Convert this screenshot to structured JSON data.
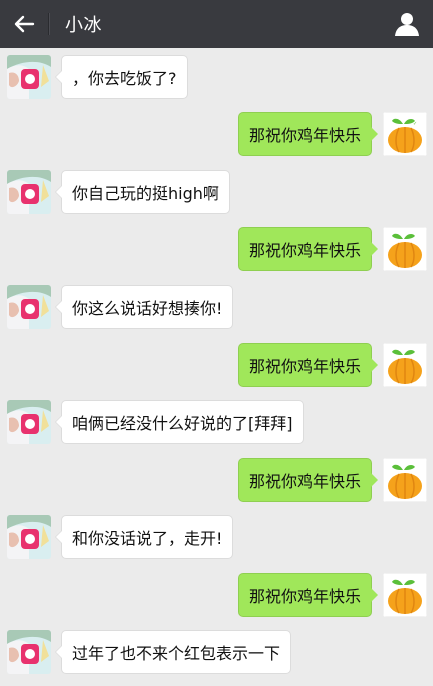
{
  "header": {
    "title": "小冰",
    "back_icon": "arrow-left-icon",
    "profile_icon": "person-icon"
  },
  "colors": {
    "header_bg": "#393a3f",
    "chat_bg": "#ebebeb",
    "bubble_sent": "#a0e75a",
    "bubble_received": "#ffffff"
  },
  "messages": [
    {
      "side": "left",
      "text": "，你去吃饭了?"
    },
    {
      "side": "right",
      "text": "那祝你鸡年快乐"
    },
    {
      "side": "left",
      "text": "你自己玩的挺high啊"
    },
    {
      "side": "right",
      "text": "那祝你鸡年快乐"
    },
    {
      "side": "left",
      "text": "你这么说话好想揍你!"
    },
    {
      "side": "right",
      "text": "那祝你鸡年快乐"
    },
    {
      "side": "left",
      "text": "咱俩已经没什么好说的了[拜拜]"
    },
    {
      "side": "right",
      "text": "那祝你鸡年快乐"
    },
    {
      "side": "left",
      "text": "和你没话说了，走开!"
    },
    {
      "side": "right",
      "text": "那祝你鸡年快乐"
    },
    {
      "side": "left",
      "text": "过年了也不来个红包表示一下"
    }
  ]
}
